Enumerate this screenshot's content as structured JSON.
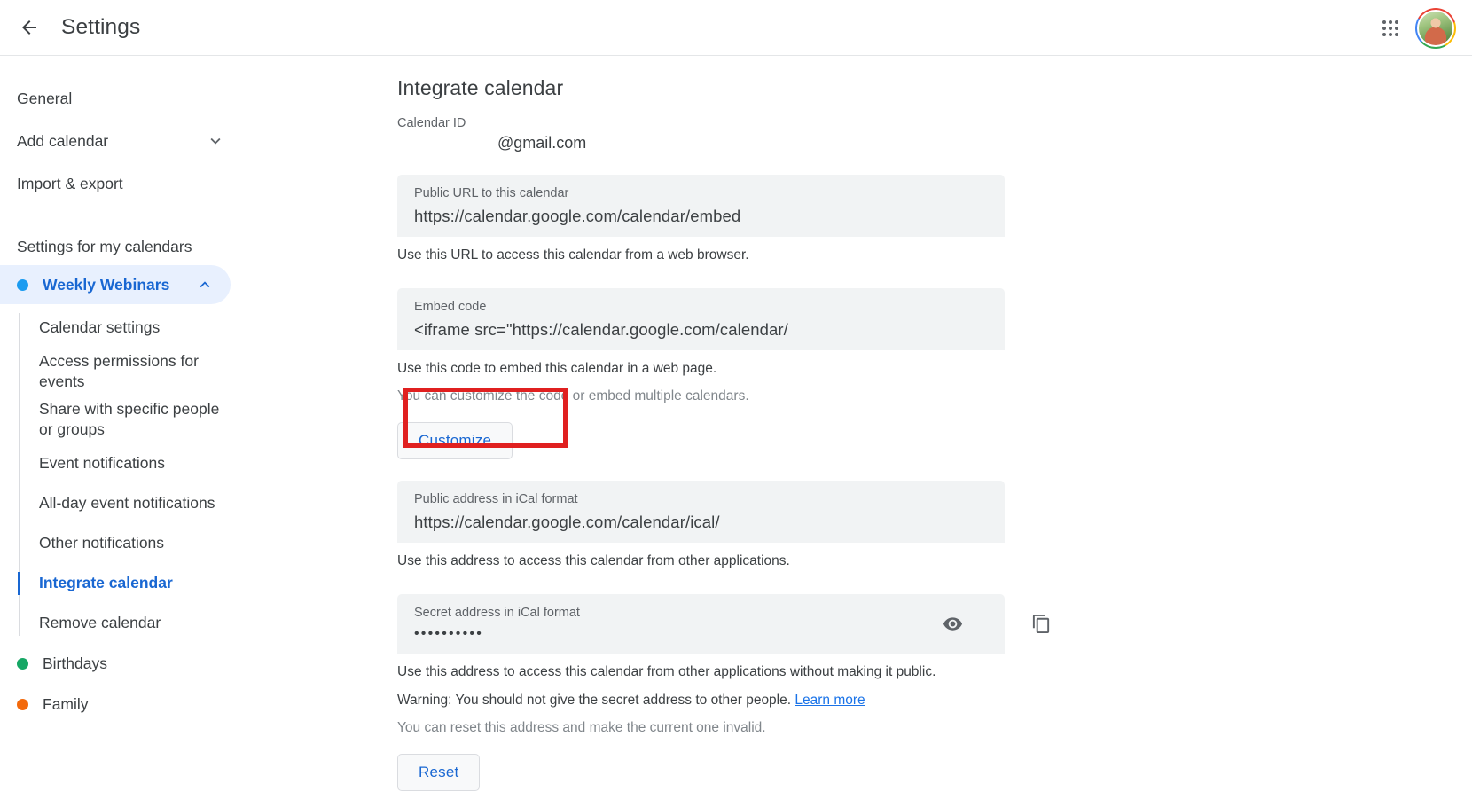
{
  "topbar": {
    "back_icon": "arrow-left-icon",
    "title": "Settings",
    "apps_icon": "apps-grid-icon",
    "avatar_label": "account-avatar"
  },
  "sidebar": {
    "nav": [
      {
        "label": "General",
        "icon": null
      },
      {
        "label": "Add calendar",
        "icon": "chevron-down-icon"
      },
      {
        "label": "Import & export",
        "icon": null
      }
    ],
    "section_title": "Settings for my calendars",
    "selected_calendar": {
      "label": "Weekly Webinars",
      "dot_color": "#1a9bf0",
      "expand_icon": "chevron-up-icon"
    },
    "sub_items": [
      {
        "label": "Calendar settings",
        "active": false
      },
      {
        "label": "Access permissions for events",
        "active": false
      },
      {
        "label": "Share with specific people or groups",
        "active": false
      },
      {
        "label": "Event notifications",
        "active": false
      },
      {
        "label": "All-day event notifications",
        "active": false
      },
      {
        "label": "Other notifications",
        "active": false
      },
      {
        "label": "Integrate calendar",
        "active": true
      },
      {
        "label": "Remove calendar",
        "active": false
      }
    ],
    "other_calendars": [
      {
        "label": "Birthdays",
        "dot_color": "#16a765"
      },
      {
        "label": "Family",
        "dot_color": "#f3690b"
      }
    ]
  },
  "main": {
    "page_title": "Integrate calendar",
    "calendar_id": {
      "label": "Calendar ID",
      "value": "@gmail.com"
    },
    "public_url": {
      "label": "Public URL to this calendar",
      "value": "https://calendar.google.com/calendar/embed",
      "helper": "Use this URL to access this calendar from a web browser."
    },
    "embed_code": {
      "label": "Embed code",
      "value": "<iframe src=\"https://calendar.google.com/calendar/",
      "helper": "Use this code to embed this calendar in a web page.",
      "helper_muted": "You can customize the code or embed multiple calendars.",
      "button_label": "Customize"
    },
    "public_ical": {
      "label": "Public address in iCal format",
      "value": "https://calendar.google.com/calendar/ical/",
      "helper": "Use this address to access this calendar from other applications."
    },
    "secret_ical": {
      "label": "Secret address in iCal format",
      "value": "••••••••••",
      "eye_icon": "visibility-eye-icon",
      "copy_icon": "copy-icon",
      "helper": "Use this address to access this calendar from other applications without making it public.",
      "warning_prefix": "Warning: You should not give the secret address to other people.",
      "learn_more": "Learn more",
      "helper_muted": "You can reset this address and make the current one invalid.",
      "button_label": "Reset"
    }
  },
  "annotation": {
    "type": "highlight-rectangle",
    "color": "#e02020",
    "targets": "customize-button"
  }
}
